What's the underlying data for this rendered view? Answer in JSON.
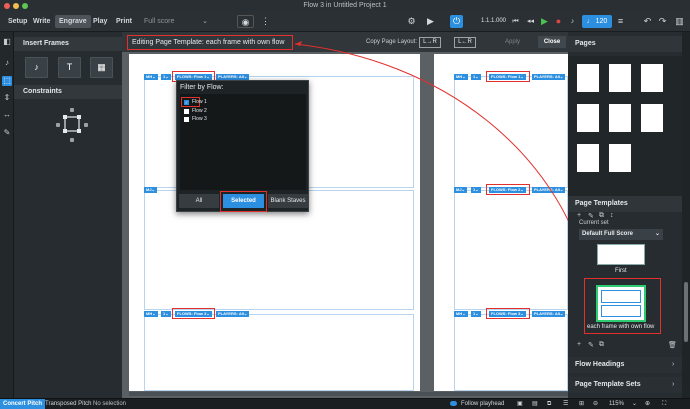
{
  "window": {
    "title": "Flow 3 in Untitled Project 1"
  },
  "toolbar": {
    "modes": [
      "Setup",
      "Write",
      "Engrave",
      "Play",
      "Print"
    ],
    "active_mode": "Engrave",
    "layout_select": "Full score",
    "transport_time": "1.1.1.000",
    "tempo": "120"
  },
  "left_panel": {
    "insert_frames_title": "Insert Frames",
    "constraints_title": "Constraints",
    "frame_buttons": [
      "♪",
      "T",
      "▦"
    ]
  },
  "editbar": {
    "label": "Editing Page Template:",
    "template_name": "each frame with own flow",
    "copy_layout_label": "Copy Page Layout:",
    "copy_lr_1": "L→R",
    "copy_lr_2": "L←R",
    "apply_label": "Apply",
    "close_label": "Close"
  },
  "frames": {
    "mh": "MH⌄",
    "one": "1⌄",
    "mj": "MJ⌄",
    "flow1": "FLOWS: Flow 1⌄",
    "flow2": "FLOWS: Flow 2⌄",
    "flow3": "FLOWS: Flow 3⌄",
    "players": "PLAYERS: All⌄",
    "players_short": "PLAYERS: All⌄"
  },
  "popup": {
    "title": "Filter by Flow:",
    "flows": [
      {
        "label": "Flow 1",
        "checked": true
      },
      {
        "label": "Flow 2",
        "checked": false
      },
      {
        "label": "Flow 3",
        "checked": false
      }
    ],
    "btn_all": "All",
    "btn_selected": "Selected",
    "btn_blank": "Blank Staves"
  },
  "right_panel": {
    "pages_title": "Pages",
    "page_templates_title": "Page Templates",
    "current_set_label": "Current set",
    "current_set_value": "Default Full Score",
    "template_first": "First",
    "template_selected": "each frame with own flow",
    "flow_headings_title": "Flow Headings",
    "page_template_sets_title": "Page Template Sets"
  },
  "statusbar": {
    "concert_pitch": "Concert Pitch",
    "transposed_pitch": "Transposed Pitch",
    "selection": "No selection",
    "follow_playhead": "Follow playhead",
    "zoom": "115%"
  },
  "colors": {
    "accent": "#2d8fe0",
    "highlight": "#e2302c",
    "selected_template": "#2ecc71"
  }
}
